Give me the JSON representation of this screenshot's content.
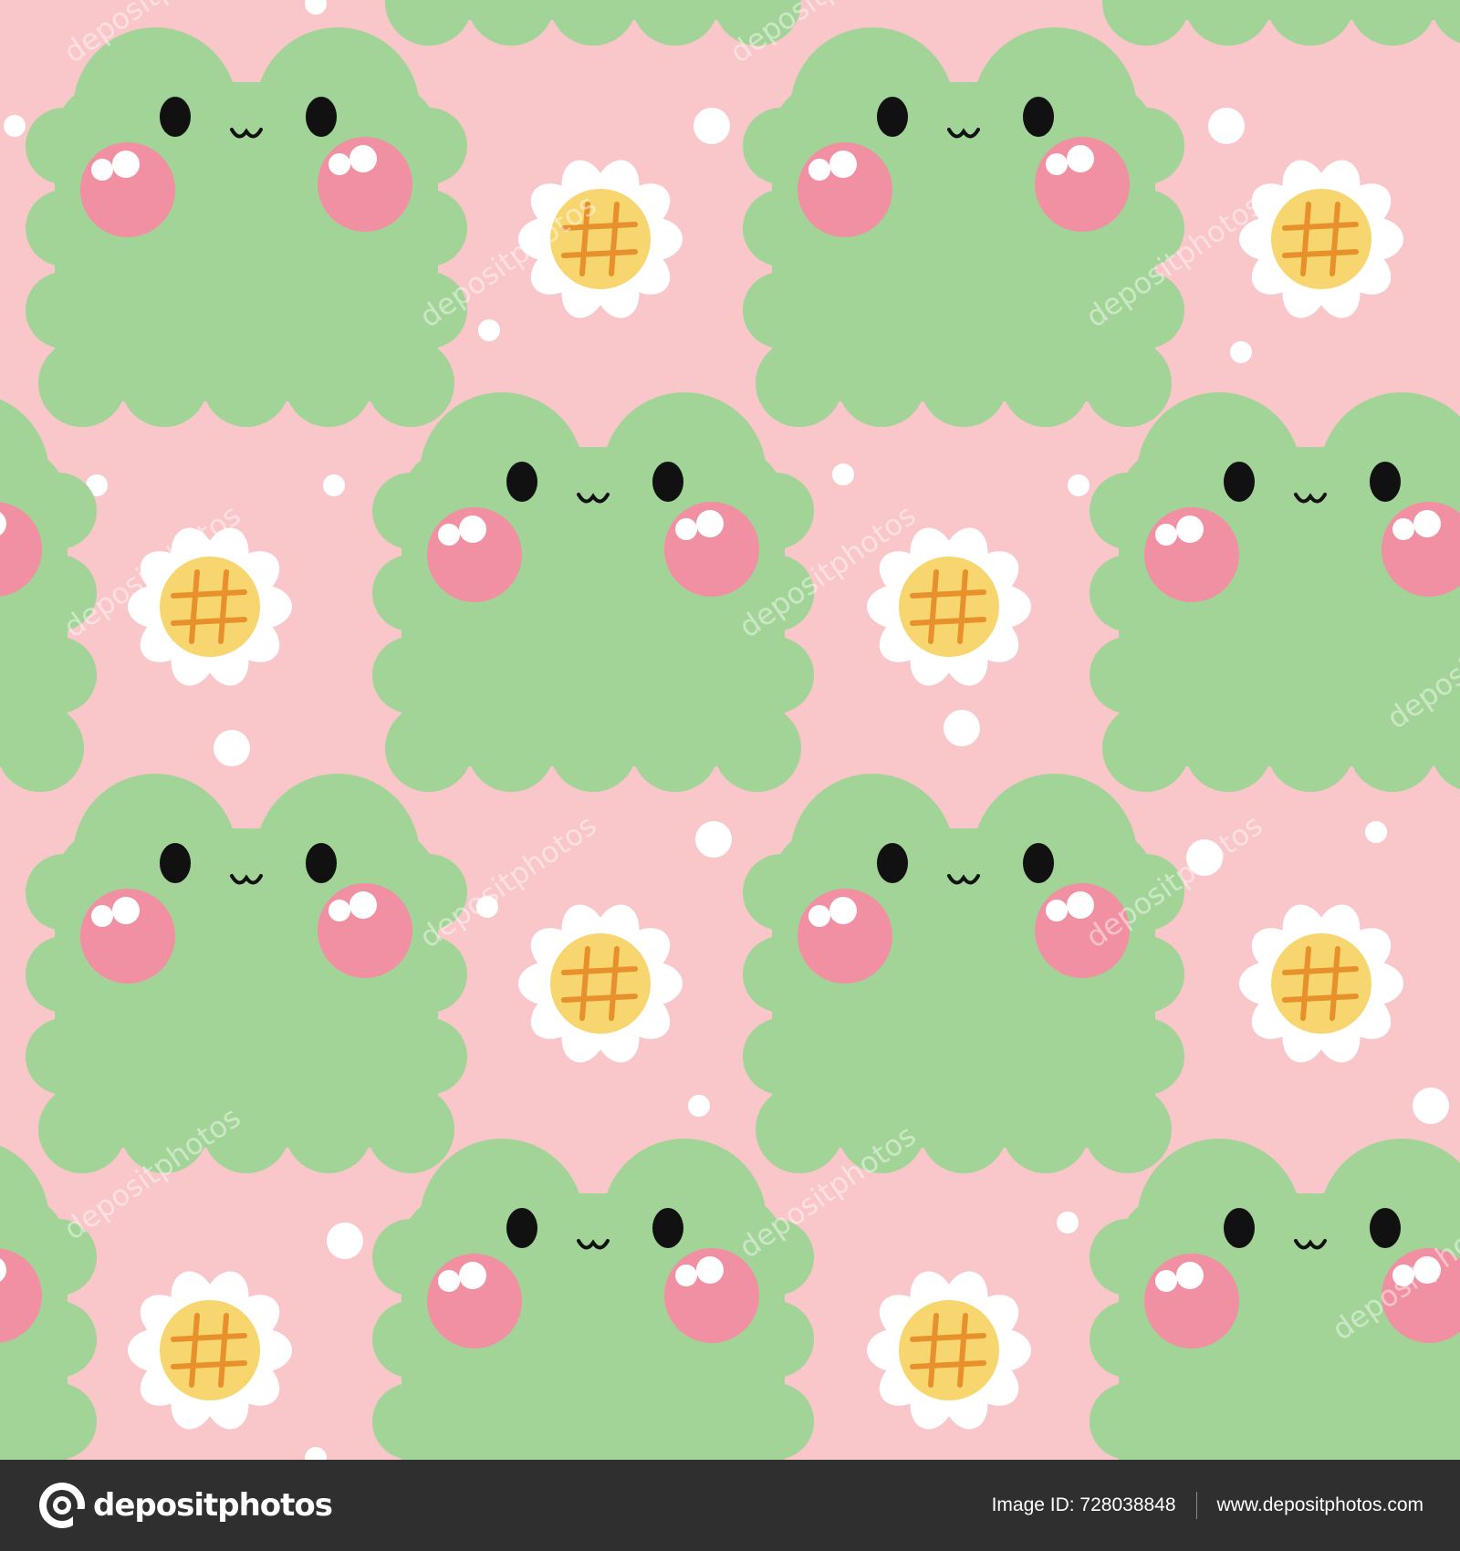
{
  "pattern": {
    "background_color": "#f9c6ca",
    "frog_color": "#a2d497",
    "cheek_color": "#f090a2",
    "eye_color": "#111111",
    "petal_color": "#ffffff",
    "flower_center_color": "#f7d670",
    "flower_grid_color": "#e8902c",
    "dot_color": "#ffffff",
    "frog_count": 12,
    "flower_count": 8
  },
  "watermark": {
    "text": "depositphotos"
  },
  "footer": {
    "background_color": "#2f2f2f",
    "logo_icon": "depositphotos-logo-icon",
    "logo_text": "depositphotos",
    "image_id": "Image ID: 728038848",
    "site_url": "www.depositphotos.com"
  }
}
